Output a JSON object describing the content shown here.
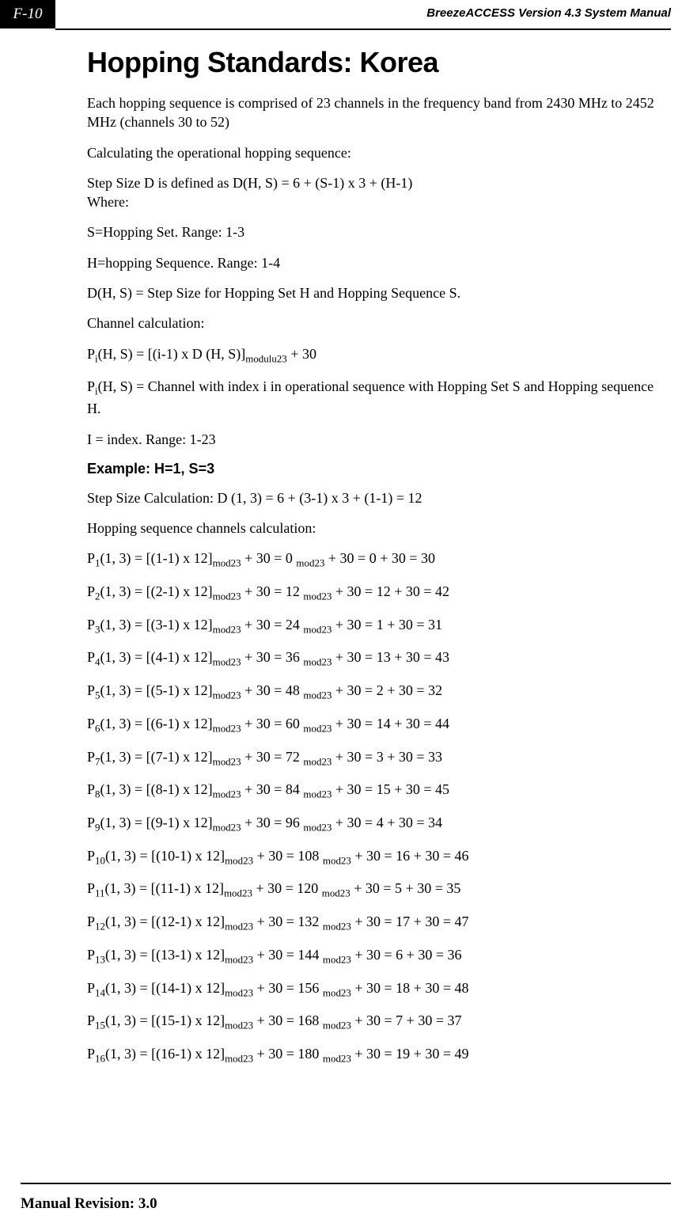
{
  "header": {
    "page_number": "F-10",
    "doc_title": "BreezeACCESS Version 4.3 System Manual"
  },
  "title": "Hopping Standards: Korea",
  "intro": {
    "p1": "Each hopping sequence is comprised of 23 channels in the frequency band from 2430 MHz to 2452 MHz (channels 30 to 52)",
    "p2": "Calculating the operational hopping sequence:",
    "p3a": "Step Size D is defined as D(H, S) = 6 + (S-1) x 3 + (H-1)",
    "p3b": "Where:",
    "p4": "S=Hopping Set. Range: 1-3",
    "p5": "H=hopping Sequence. Range: 1-4",
    "p6": "D(H, S) = Step Size for Hopping Set H and Hopping Sequence S.",
    "p7": "Channel calculation:"
  },
  "formula1": {
    "pre": "P",
    "sub": "i",
    "mid": "(H, S) = [(i-1) x D (H, S)]",
    "sub2": "modulu23",
    "post": " + 30"
  },
  "formula2": {
    "pre": "P",
    "sub": "i",
    "post": "(H, S) = Channel with index i in operational sequence with Hopping Set S and Hopping sequence H."
  },
  "p_index": "I = index. Range: 1-23",
  "example_label": "Example: H=1, S=3",
  "step_calc": "Step Size Calculation: D (1, 3) = 6 + (3-1) x 3 + (1-1) = 12",
  "hop_calc_label": "Hopping sequence channels calculation:",
  "calcs": [
    {
      "sub": "1",
      "a": "(1, 3) = [(1-1) x 12]",
      "b": " + 30 = 0 ",
      "c": " + 30 = 0 + 30 = 30"
    },
    {
      "sub": "2",
      "a": "(1, 3) = [(2-1) x 12]",
      "b": " + 30 = 12 ",
      "c": " + 30 = 12 + 30 = 42"
    },
    {
      "sub": "3",
      "a": "(1, 3) = [(3-1) x 12]",
      "b": " + 30 = 24 ",
      "c": " + 30 = 1 + 30 = 31"
    },
    {
      "sub": "4",
      "a": "(1, 3) = [(4-1) x 12]",
      "b": " + 30 = 36 ",
      "c": " + 30 = 13 + 30 = 43"
    },
    {
      "sub": "5",
      "a": "(1, 3) = [(5-1) x 12]",
      "b": " + 30 = 48 ",
      "c": " + 30 = 2 + 30 = 32"
    },
    {
      "sub": "6",
      "a": "(1, 3) = [(6-1) x 12]",
      "b": " + 30 = 60 ",
      "c": " + 30 = 14 + 30 = 44"
    },
    {
      "sub": "7",
      "a": "(1, 3) = [(7-1) x 12]",
      "b": " + 30 = 72 ",
      "c": " + 30 = 3 + 30 = 33"
    },
    {
      "sub": "8",
      "a": "(1, 3) = [(8-1) x 12]",
      "b": " + 30 = 84 ",
      "c": " + 30 = 15 + 30 = 45"
    },
    {
      "sub": "9",
      "a": "(1, 3) = [(9-1) x 12]",
      "b": " + 30 = 96 ",
      "c": " + 30 = 4 + 30 = 34"
    },
    {
      "sub": "10",
      "a": "(1, 3) = [(10-1) x 12]",
      "b": " + 30 = 108 ",
      "c": " + 30 = 16 + 30 = 46"
    },
    {
      "sub": "11",
      "a": "(1, 3) = [(11-1) x 12]",
      "b": " + 30 = 120 ",
      "c": " + 30 = 5 + 30 = 35"
    },
    {
      "sub": "12",
      "a": "(1, 3) = [(12-1) x 12]",
      "b": " + 30 = 132 ",
      "c": " + 30 = 17 + 30 = 47"
    },
    {
      "sub": "13",
      "a": "(1, 3) = [(13-1) x 12]",
      "b": " + 30 = 144 ",
      "c": " + 30 = 6 + 30 = 36"
    },
    {
      "sub": "14",
      "a": "(1, 3) = [(14-1) x 12]",
      "b": " + 30 = 156 ",
      "c": " + 30 = 18 + 30 = 48"
    },
    {
      "sub": "15",
      "a": "(1, 3) = [(15-1) x 12]",
      "b": " + 30 = 168 ",
      "c": " + 30 = 7 + 30 = 37"
    },
    {
      "sub": "16",
      "a": "(1, 3) = [(16-1) x 12]",
      "b": " + 30 = 180 ",
      "c": " + 30 = 19 + 30 = 49"
    }
  ],
  "mod_label": "mod23",
  "footer": {
    "revision": "Manual Revision: 3.0"
  }
}
